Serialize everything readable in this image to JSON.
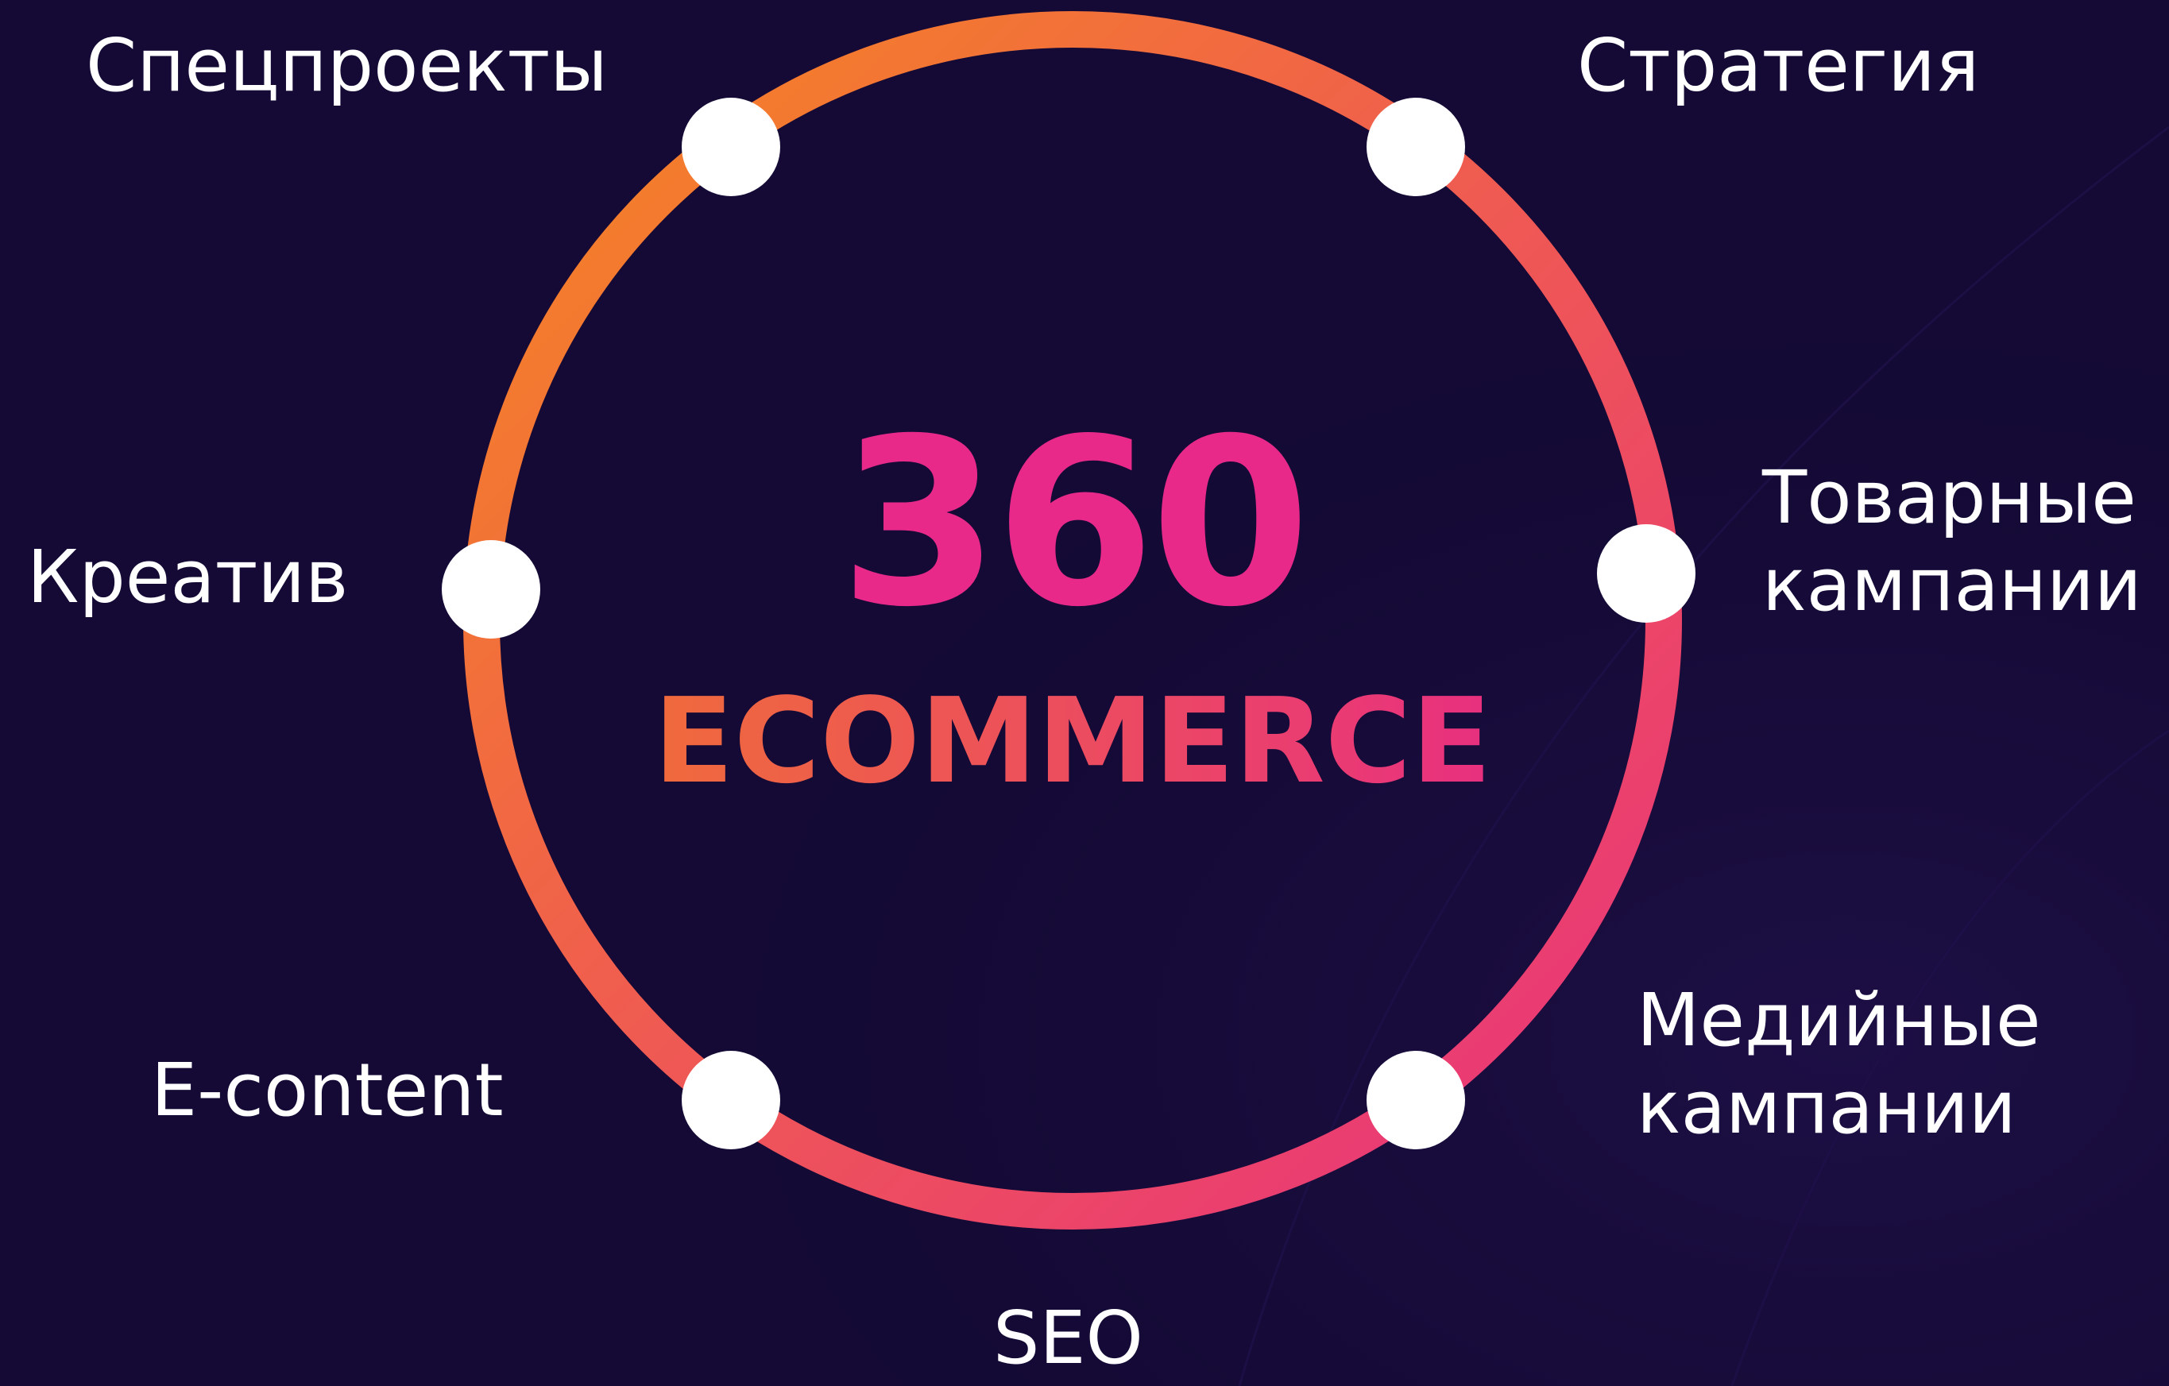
{
  "diagram": {
    "center": {
      "number": "360",
      "word": "ECOMMERCE"
    },
    "nodes": [
      {
        "id": "specprojects",
        "label_lines": [
          "Спецпроекты"
        ]
      },
      {
        "id": "strategy",
        "label_lines": [
          "Стратегия"
        ]
      },
      {
        "id": "product_campaigns",
        "label_lines": [
          "Товарные",
          "кампании"
        ]
      },
      {
        "id": "media_campaigns",
        "label_lines": [
          "Медийные",
          "кампании"
        ]
      },
      {
        "id": "seo",
        "label_lines": [
          "SEO"
        ]
      },
      {
        "id": "econtent",
        "label_lines": [
          "E-content"
        ]
      },
      {
        "id": "creative",
        "label_lines": [
          "Креатив"
        ]
      }
    ],
    "colors": {
      "background": "#140a35",
      "ring_orange": "#f28a22",
      "ring_pink": "#e8307f",
      "node_fill": "#ffffff",
      "label_text": "#ffffff",
      "number_color": "#e8298a"
    }
  }
}
